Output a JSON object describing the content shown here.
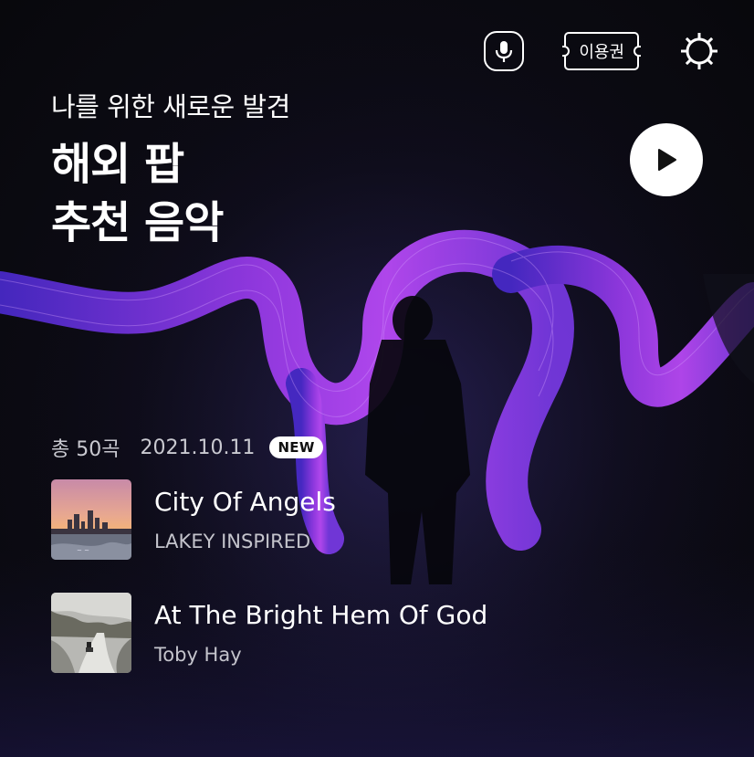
{
  "header": {
    "ticket_label": "이용권",
    "icons": [
      "microphone-icon",
      "ticket-icon",
      "settings-icon"
    ]
  },
  "hero": {
    "subtitle": "나를 위한 새로운 발견",
    "title_line1": "해외 팝",
    "title_line2": "추천 음악",
    "play_icon": "play-icon"
  },
  "playlist": {
    "count": "총 50곡",
    "date": "2021.10.11",
    "badge": "NEW",
    "tracks": [
      {
        "title": "City Of Angels",
        "artist": "LAKEY INSPIRED"
      },
      {
        "title": "At The Bright Hem Of God",
        "artist": "Toby Hay"
      }
    ]
  },
  "colors": {
    "accent": "#8a3cff",
    "light_trail": "#b04cff",
    "background": "#0a0a0f"
  }
}
